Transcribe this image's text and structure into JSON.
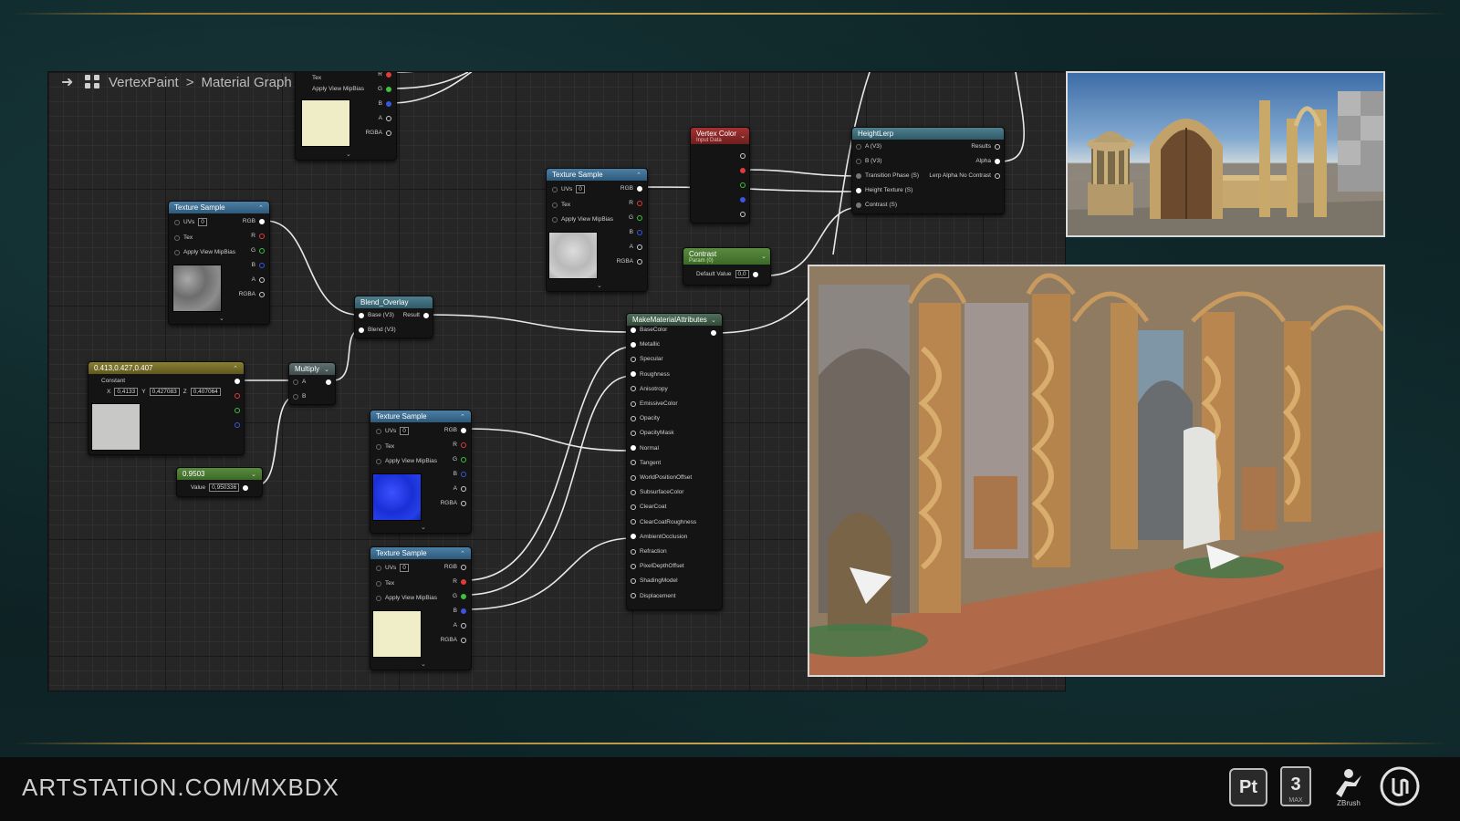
{
  "breadcrumb": {
    "root": "VertexPaint",
    "separator": ">",
    "current": "Material Graph"
  },
  "nodes": {
    "top_tex": {
      "pins_left": [
        "Tex",
        "Apply View MipBias"
      ],
      "pins_right": [
        "R",
        "G",
        "B",
        "A",
        "RGBA"
      ]
    },
    "tex1": {
      "title": "Texture Sample",
      "uvs_label": "UVs",
      "uvs_value": "0",
      "tex_label": "Tex",
      "mip_label": "Apply View MipBias",
      "outputs": [
        "RGB",
        "R",
        "G",
        "B",
        "A",
        "RGBA"
      ]
    },
    "tex2": {
      "title": "Texture Sample",
      "uvs_label": "UVs",
      "uvs_value": "0",
      "tex_label": "Tex",
      "mip_label": "Apply View MipBias",
      "outputs": [
        "RGB",
        "R",
        "G",
        "B",
        "A",
        "RGBA"
      ]
    },
    "tex3": {
      "title": "Texture Sample",
      "uvs_label": "UVs",
      "uvs_value": "0",
      "tex_label": "Tex",
      "mip_label": "Apply View MipBias",
      "outputs": [
        "RGB",
        "R",
        "G",
        "B",
        "A",
        "RGBA"
      ]
    },
    "tex4": {
      "title": "Texture Sample",
      "uvs_label": "UVs",
      "uvs_value": "0",
      "tex_label": "Tex",
      "mip_label": "Apply View MipBias",
      "outputs": [
        "RGB",
        "R",
        "G",
        "B",
        "A",
        "RGBA"
      ]
    },
    "const3": {
      "title": "0.413,0.427,0.407",
      "label": "Constant",
      "x_label": "X",
      "x_value": "0,4133",
      "y_label": "Y",
      "y_value": "0,427083",
      "z_label": "Z",
      "z_value": "0,407064"
    },
    "scalar": {
      "title": "0.9503",
      "label": "Value",
      "value": "0,950336"
    },
    "multiply": {
      "title": "Multiply",
      "a": "A",
      "b": "B"
    },
    "blend": {
      "title": "Blend_Overlay",
      "base": "Base (V3)",
      "blend": "Blend (V3)",
      "result": "Result"
    },
    "vertex_color": {
      "title": "Vertex Color",
      "subtitle": "Input Data"
    },
    "contrast": {
      "title": "Contrast",
      "subtitle": "Param (0)",
      "label": "Default Value",
      "value": "0,0"
    },
    "heightlerp": {
      "title": "HeightLerp",
      "inputs": [
        "A (V3)",
        "B (V3)",
        "Transition Phase (S)",
        "Height Texture (S)",
        "Contrast (S)"
      ],
      "outputs": [
        "Results",
        "Alpha",
        "Lerp Alpha No Contrast"
      ]
    },
    "mma": {
      "title": "MakeMaterialAttributes",
      "inputs": [
        "BaseColor",
        "Metallic",
        "Specular",
        "Roughness",
        "Anisotropy",
        "EmissiveColor",
        "Opacity",
        "OpacityMask",
        "Normal",
        "Tangent",
        "WorldPositionOffset",
        "SubsurfaceColor",
        "ClearCoat",
        "ClearCoatRoughness",
        "AmbientOcclusion",
        "Refraction",
        "PixelDepthOffset",
        "ShadingModel",
        "Displacement"
      ]
    }
  },
  "footer": {
    "url": "ARTSTATION.COM/MXBDX",
    "logo_pt": "Pt",
    "logo_max_num": "3",
    "logo_max_sub": "MAX",
    "logo_zb": "ZBrush"
  },
  "colors": {
    "frame_bg": "#0f2628",
    "gold": "#c7a24f",
    "graph_bg": "#262626",
    "wire": "#e8e8e8"
  },
  "icons": [
    "arrow-right-icon",
    "graph-icon",
    "photoshop-painter-logo",
    "3dsmax-logo",
    "zbrush-logo",
    "unreal-logo"
  ]
}
